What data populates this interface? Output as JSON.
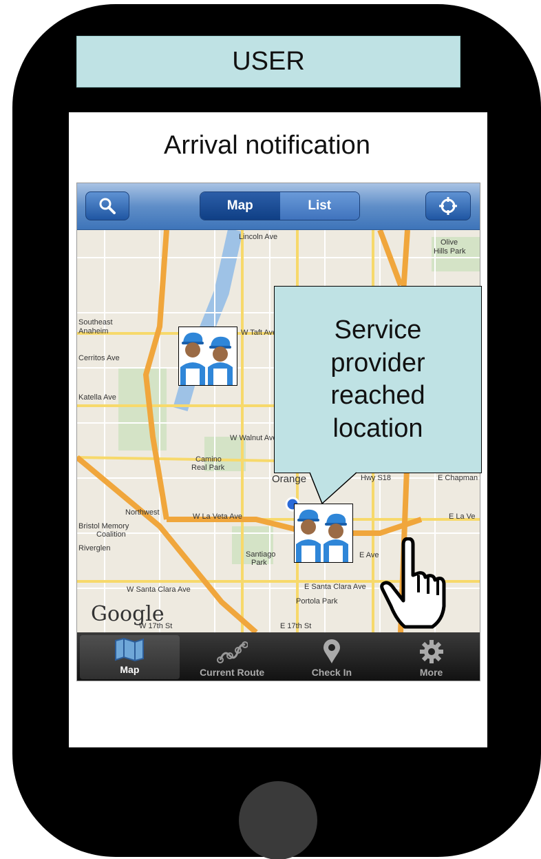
{
  "banner": {
    "label": "USER"
  },
  "screen_title": "Arrival notification",
  "navbar": {
    "search_icon": "search-icon",
    "segments": [
      {
        "label": "Map",
        "active": true
      },
      {
        "label": "List",
        "active": false
      }
    ],
    "locate_icon": "crosshair-icon"
  },
  "map": {
    "labels": [
      "Lincoln Ave",
      "Olive",
      "Hills Park",
      "Southeast",
      "Anaheim",
      "Cerritos Ave",
      "Katella Ave",
      "W Taft Ave",
      "W Walnut Ave",
      "Camino",
      "Real Park",
      "Orange",
      "Hwy S18",
      "E Chapman",
      "Northwest",
      "W La Veta Ave",
      "E La Ve",
      "Bristol Memory",
      "Coalition",
      "Riverglen",
      "Santiago",
      "Park",
      "W Santa Clara Ave",
      "E Santa Clara Ave",
      "Portola Park",
      "W 17th St",
      "E 17th St",
      "E Ave"
    ],
    "attribution": "Google"
  },
  "callout": {
    "text": "Service provider reached location"
  },
  "tabbar": {
    "tabs": [
      {
        "label": "Map",
        "icon": "map-icon",
        "active": true
      },
      {
        "label": "Current Route",
        "icon": "route-icon",
        "active": false
      },
      {
        "label": "Check In",
        "icon": "location-pin-icon",
        "active": false
      },
      {
        "label": "More",
        "icon": "gear-icon",
        "active": false
      }
    ]
  },
  "colors": {
    "accent": "#bfe2e4",
    "navbar": "#3e74b9",
    "phone": "#000000"
  }
}
